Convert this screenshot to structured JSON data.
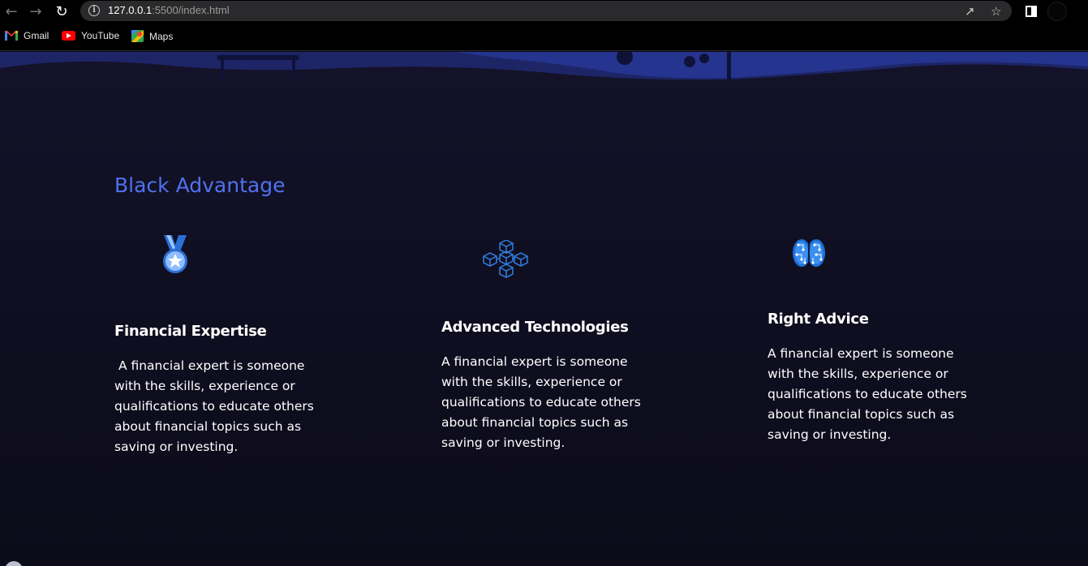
{
  "browser": {
    "url_host": "127.0.0.1",
    "url_rest": ":5500/index.html",
    "bookmarks": [
      {
        "label": "Gmail",
        "icon": "gmail-icon"
      },
      {
        "label": "YouTube",
        "icon": "youtube-icon"
      },
      {
        "label": "Maps",
        "icon": "maps-icon"
      }
    ]
  },
  "section": {
    "title": "Black Advantage",
    "title_color": "#4f72ee"
  },
  "cards": [
    {
      "icon": "medal-icon",
      "title": "Financial Expertise",
      "text": " A financial expert is someone with the skills, experience or qualifications to educate others about financial topics such as saving or investing."
    },
    {
      "icon": "blockchain-cubes-icon",
      "title": "Advanced Technologies",
      "text": "A financial expert is someone with the skills, experience or qualifications to educate others about financial topics such as saving or investing."
    },
    {
      "icon": "brain-icon",
      "title": "Right Advice",
      "text": "A financial expert is someone with the skills, experience or qualifications to educate others about financial topics such as saving or investing."
    }
  ],
  "colors": {
    "background": "#0c0b1a",
    "accent": "#4f72ee",
    "text": "#ffffff"
  }
}
